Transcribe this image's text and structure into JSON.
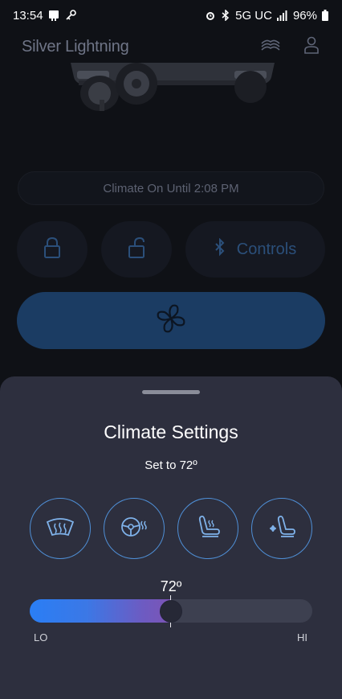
{
  "status_bar": {
    "time": "13:54",
    "network": "5G UC",
    "battery": "96%",
    "icons_left": [
      "notification-icon",
      "key-icon"
    ],
    "icons_right": [
      "alarm-icon",
      "bluetooth-icon",
      "signal-icon",
      "battery-icon"
    ]
  },
  "app": {
    "title": "Silver Lightning",
    "header_icons": [
      "vehicle-icon",
      "account-icon"
    ]
  },
  "vehicle_panel": {
    "climate_status": "Climate On Until 2:08 PM",
    "controls_label": "Controls",
    "buttons": [
      "lock",
      "unlock",
      "controls",
      "climate-fan"
    ]
  },
  "climate_sheet": {
    "title": "Climate Settings",
    "subtitle": "Set to 72º",
    "features": [
      "front-defrost",
      "heated-steering-wheel",
      "heated-seat",
      "ventilated-seat"
    ],
    "temperature": {
      "value_label": "72º",
      "level": 0.5,
      "min_label": "LO",
      "max_label": "HI"
    }
  },
  "colors": {
    "sheet_bg": "#2d2f3e",
    "accent": "#4f8fd6",
    "slider_start": "#2a7ef5",
    "slider_end": "#7c54b5",
    "fan_button": "#1b3c63"
  }
}
